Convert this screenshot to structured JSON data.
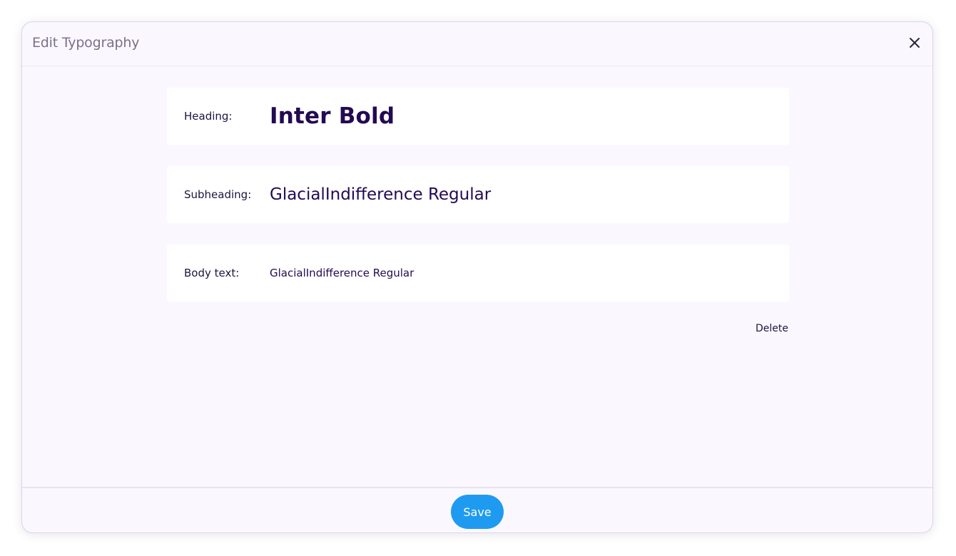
{
  "dialog": {
    "title": "Edit Typography",
    "close_icon": "close-icon"
  },
  "rows": [
    {
      "label": "Heading:",
      "value": "Inter Bold"
    },
    {
      "label": "Subheading:",
      "value": "GlacialIndifference Regular"
    },
    {
      "label": "Body text:",
      "value": "GlacialIndifference Regular"
    }
  ],
  "actions": {
    "delete_label": "Delete",
    "save_label": "Save"
  },
  "colors": {
    "accent": "#1e9bf0",
    "text_dark": "#230a52",
    "dialog_background": "#faf8fe"
  }
}
